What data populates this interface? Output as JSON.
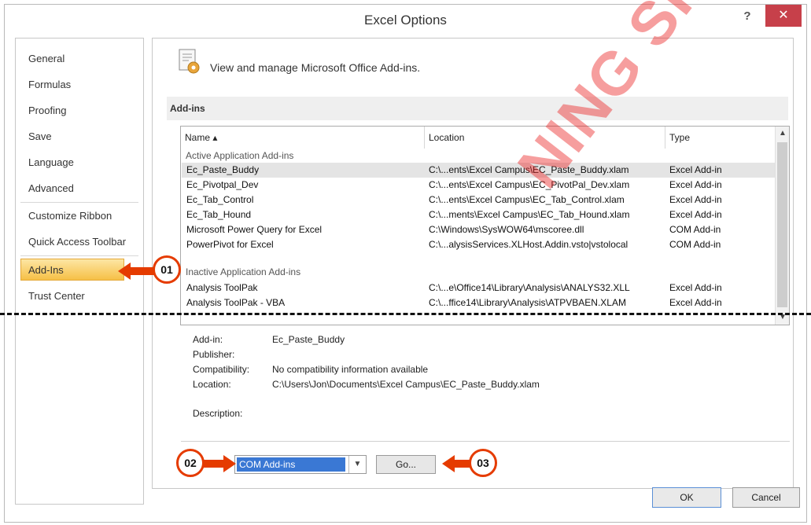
{
  "window": {
    "title": "Excel Options",
    "help": "?",
    "close": "✕"
  },
  "sidebar": {
    "items": [
      {
        "label": "General"
      },
      {
        "label": "Formulas"
      },
      {
        "label": "Proofing"
      },
      {
        "label": "Save"
      },
      {
        "label": "Language"
      },
      {
        "label": "Advanced"
      },
      {
        "label": "Customize Ribbon"
      },
      {
        "label": "Quick Access Toolbar"
      },
      {
        "label": "Add-Ins"
      },
      {
        "label": "Trust Center"
      }
    ],
    "active": "Add-Ins"
  },
  "main": {
    "header": "View and manage Microsoft Office Add-ins.",
    "section_title": "Add-ins",
    "table": {
      "columns": [
        "Name ▴",
        "Location",
        "Type"
      ],
      "group_active": "Active Application Add-ins",
      "group_inactive": "Inactive Application Add-ins",
      "active_rows": [
        {
          "name": "Ec_Paste_Buddy",
          "location": "C:\\...ents\\Excel Campus\\EC_Paste_Buddy.xlam",
          "type": "Excel Add-in"
        },
        {
          "name": "Ec_Pivotpal_Dev",
          "location": "C:\\...ents\\Excel Campus\\EC_PivotPal_Dev.xlam",
          "type": "Excel Add-in"
        },
        {
          "name": "Ec_Tab_Control",
          "location": "C:\\...ents\\Excel Campus\\EC_Tab_Control.xlam",
          "type": "Excel Add-in"
        },
        {
          "name": "Ec_Tab_Hound",
          "location": "C:\\...ments\\Excel Campus\\EC_Tab_Hound.xlam",
          "type": "Excel Add-in"
        },
        {
          "name": "Microsoft Power Query for Excel",
          "location": "C:\\Windows\\SysWOW64\\mscoree.dll",
          "type": "COM Add-in"
        },
        {
          "name": "PowerPivot for Excel",
          "location": "C:\\...alysisServices.XLHost.Addin.vsto|vstolocal",
          "type": "COM Add-in"
        }
      ],
      "inactive_rows": [
        {
          "name": "Analysis ToolPak",
          "location": "C:\\...e\\Office14\\Library\\Analysis\\ANALYS32.XLL",
          "type": "Excel Add-in"
        },
        {
          "name": "Analysis ToolPak - VBA",
          "location": "C:\\...ffice14\\Library\\Analysis\\ATPVBAEN.XLAM",
          "type": "Excel Add-in"
        }
      ]
    },
    "details": {
      "addin_label": "Add-in:",
      "addin_value": "Ec_Paste_Buddy",
      "publisher_label": "Publisher:",
      "publisher_value": "",
      "compat_label": "Compatibility:",
      "compat_value": "No compatibility information available",
      "location_label": "Location:",
      "location_value": "C:\\Users\\Jon\\Documents\\Excel Campus\\EC_Paste_Buddy.xlam",
      "description_label": "Description:"
    },
    "manage": {
      "selected": "COM Add-ins",
      "go_label": "Go..."
    }
  },
  "footer": {
    "ok_label": "OK",
    "cancel_label": "Cancel"
  },
  "callouts": {
    "c1": "01",
    "c2": "02",
    "c3": "03"
  },
  "watermark": "NING SINGAP",
  "colors": {
    "accent_callout": "#e53b00",
    "selection_blue": "#3a78d4",
    "close_red": "#c7404a",
    "nav_active": "#f6c046"
  }
}
